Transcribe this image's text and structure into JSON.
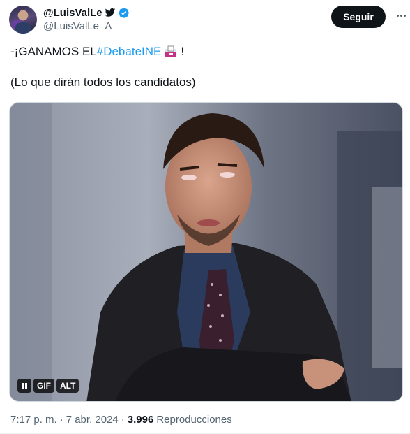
{
  "author": {
    "display_name": "@LuisValLe",
    "handle": "@LuisValLe_A",
    "avatar_icon": "avatar-photo",
    "verified_badge_color": "#1d9bf0"
  },
  "follow_button": {
    "label": "Seguir"
  },
  "tweet": {
    "text_prefix": "-¡GANAMOS EL ",
    "hashtag": "#DebateINE",
    "text_suffix": "!",
    "second_line": "(Lo que dirán todos los candidatos)",
    "hashtag_color": "#1d9bf0"
  },
  "media": {
    "type_label": "GIF",
    "alt_label": "ALT",
    "pause_icon": "pause-icon"
  },
  "meta": {
    "time": "7:17 p. m.",
    "separator": "·",
    "date": "7 abr. 2024",
    "views_count": "3.996",
    "views_label": "Reproducciones"
  }
}
